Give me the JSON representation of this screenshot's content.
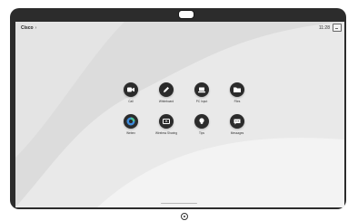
{
  "topbar": {
    "brand": "Cisco",
    "chevron": "›",
    "time": "11:28",
    "system_icon": "device-settings-icon"
  },
  "apps": [
    {
      "label": "Call",
      "icon": "video-camera-icon"
    },
    {
      "label": "Whiteboard",
      "icon": "pencil-icon"
    },
    {
      "label": "PC Input",
      "icon": "laptop-icon"
    },
    {
      "label": "Files",
      "icon": "folder-icon"
    },
    {
      "label": "Webex",
      "icon": "webex-logo-icon"
    },
    {
      "label": "Wireless Sharing",
      "icon": "screen-share-icon"
    },
    {
      "label": "Tips",
      "icon": "lightbulb-icon"
    },
    {
      "label": "Messages",
      "icon": "chat-bubble-icon"
    }
  ],
  "colors": {
    "tile": "#2b2b2b",
    "icon": "#ffffff",
    "webex_blue": "#3d8bdb",
    "webex_green": "#49c199"
  }
}
